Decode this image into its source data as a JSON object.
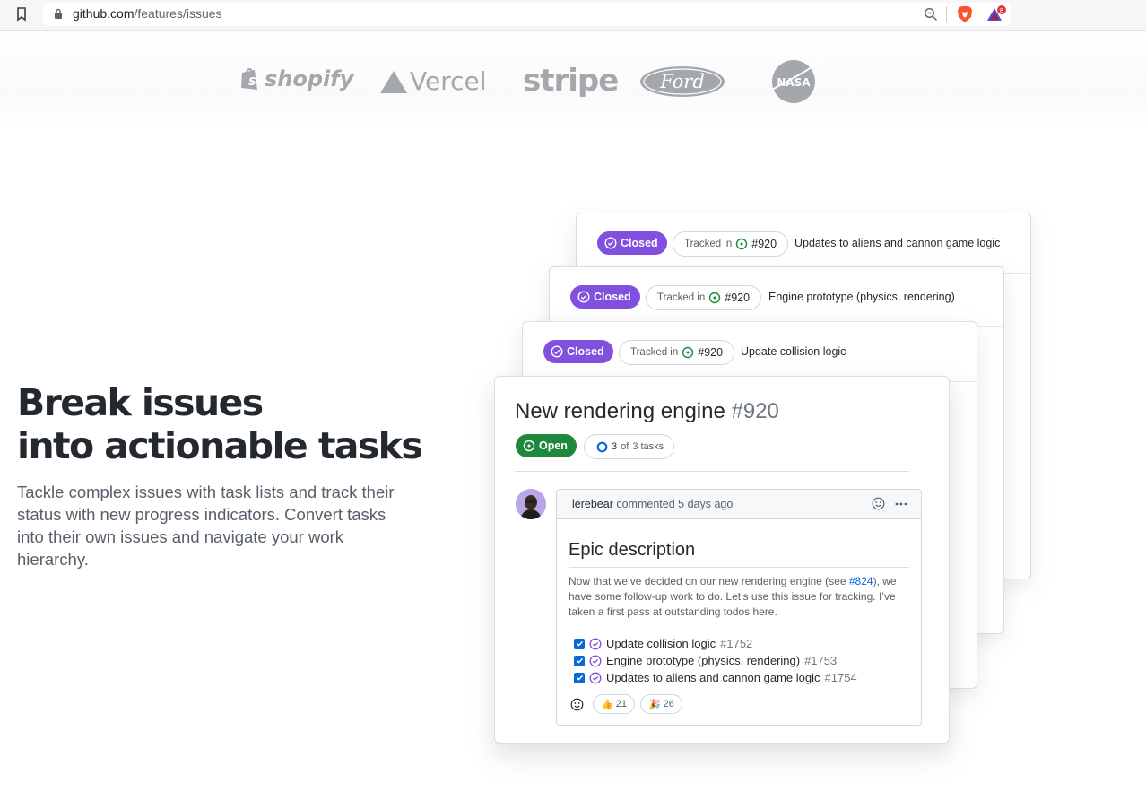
{
  "browser": {
    "url_domain": "github.com",
    "url_path": "/features/issues",
    "rewards_count": "8"
  },
  "logos": {
    "shopify": "shopify",
    "vercel": "Vercel",
    "stripe": "stripe",
    "ford": "Ford",
    "nasa": "NASA"
  },
  "hero": {
    "headline_line1": "Break issues",
    "headline_line2": "into actionable tasks",
    "subcopy": "Tackle complex issues with task lists and track their status with new progress indicators. Convert tasks into their own issues and navigate your work hierarchy."
  },
  "stacked_issues": [
    {
      "status": "Closed",
      "tracked_label": "Tracked in",
      "tracked_num": "#920",
      "title": "Updates to aliens and cannon game logic"
    },
    {
      "status": "Closed",
      "tracked_label": "Tracked in",
      "tracked_num": "#920",
      "title": "Engine prototype (physics, rendering)"
    },
    {
      "status": "Closed",
      "tracked_label": "Tracked in",
      "tracked_num": "#920",
      "title": "Update collision logic"
    }
  ],
  "main_issue": {
    "title": "New rendering engine",
    "number": "#920",
    "status": "Open",
    "tasks_done": "3",
    "tasks_of": "of",
    "tasks_total": "3 tasks",
    "comment": {
      "author": "lerebear",
      "meta": "commented 5 days ago",
      "heading": "Epic description",
      "body_before": "Now that we’ve decided on our new rendering engine (see ",
      "body_link": "#824",
      "body_after": "), we have some follow-up work to do. Let’s use this issue for tracking. I’ve taken a first pass at outstanding todos here.",
      "tasks": [
        {
          "label": "Update collision logic",
          "num": "#1752"
        },
        {
          "label": "Engine prototype (physics, rendering)",
          "num": "#1753"
        },
        {
          "label": "Updates to aliens and cannon game logic",
          "num": "#1754"
        }
      ],
      "reactions": [
        {
          "emoji": "👍",
          "count": "21"
        },
        {
          "emoji": "🎉",
          "count": "26"
        }
      ]
    }
  },
  "colors": {
    "closed": "#8250df",
    "open": "#1f883d",
    "link": "#0969da"
  }
}
